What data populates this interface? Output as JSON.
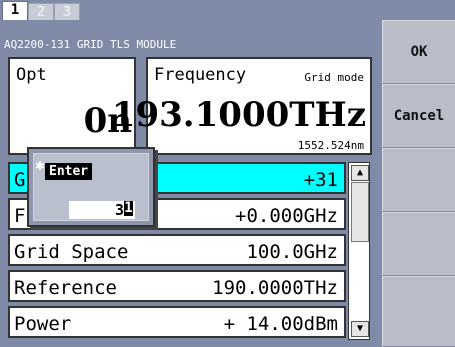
{
  "tabs": [
    "1",
    "2",
    "3"
  ],
  "module_title": "AQ2200-131 GRID TLS MODULE",
  "opt": {
    "label": "Opt",
    "value": "0n"
  },
  "frequency": {
    "label": "Frequency",
    "mode": "Grid mode",
    "value": "193.1000THz",
    "wavelength": "1552.524nm"
  },
  "rows": [
    {
      "label": "Gr",
      "value": "+31"
    },
    {
      "label": "F",
      "value": "+0.000GHz"
    },
    {
      "label": "Grid Space",
      "value": "100.0GHz"
    },
    {
      "label": "Reference",
      "value": "190.0000THz"
    },
    {
      "label": "Power",
      "value": "+ 14.00dBm"
    }
  ],
  "side_buttons": {
    "ok": "OK",
    "cancel": "Cancel"
  },
  "enter_dialog": {
    "title": "Enter",
    "value": "3",
    "cursor_char": "1"
  }
}
